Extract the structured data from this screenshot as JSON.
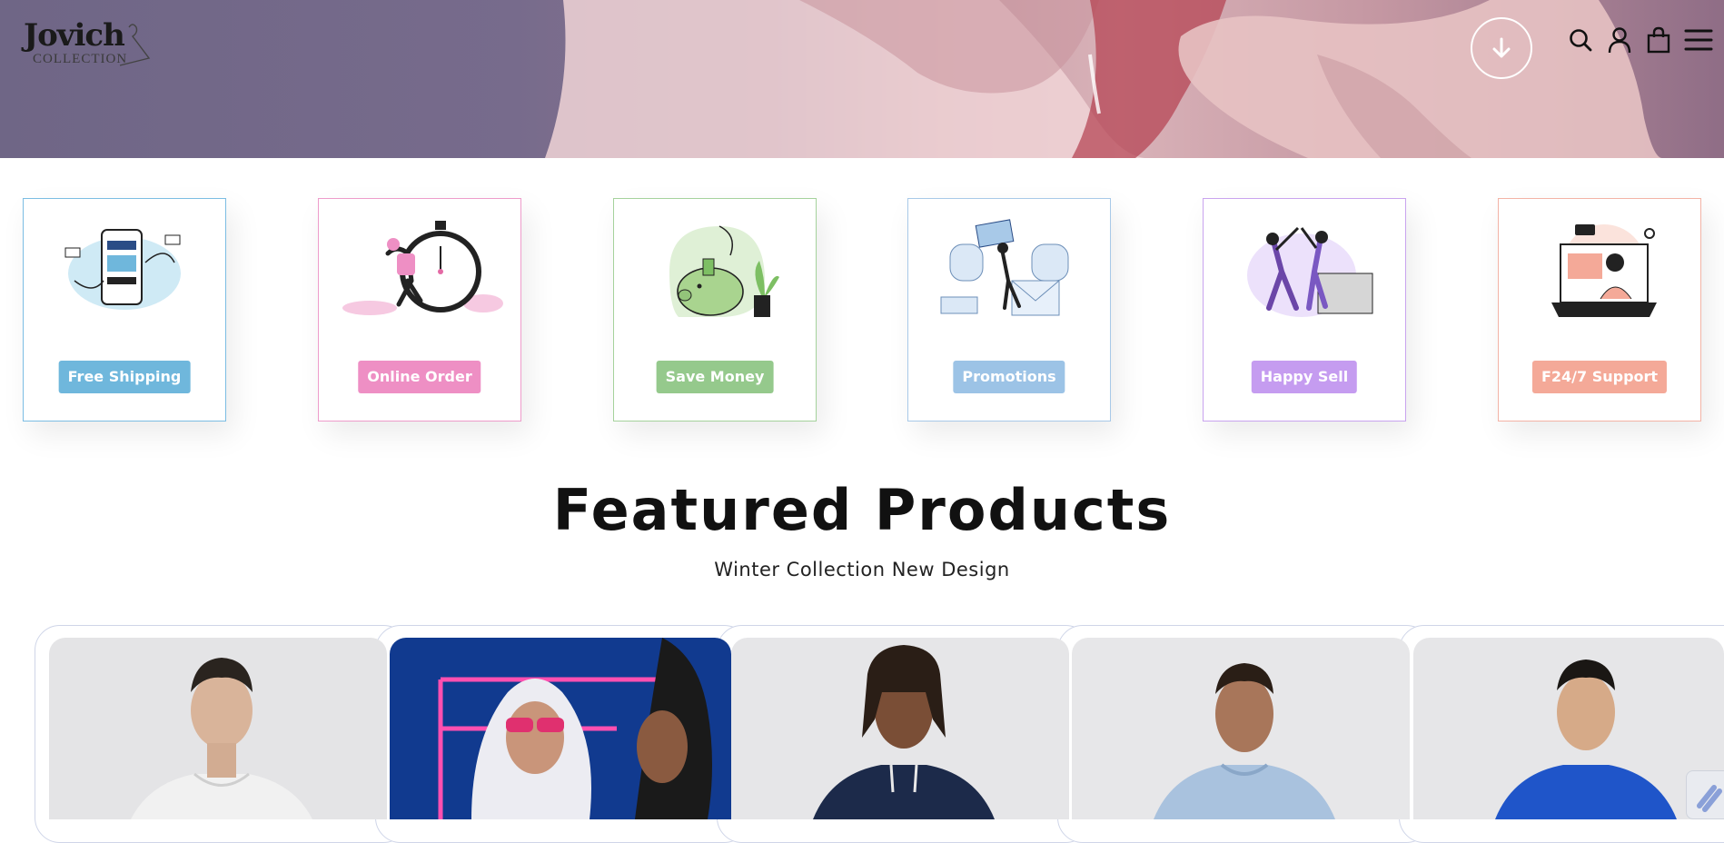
{
  "brand": {
    "name": "Jovich",
    "subtitle": "COLLECTION"
  },
  "header": {
    "icons": [
      "arrow-down-icon",
      "search-icon",
      "user-icon",
      "bag-icon",
      "menu-icon"
    ]
  },
  "features": [
    {
      "label": "Free Shipping",
      "color": "#6fb7dc",
      "border": "#7cbde3",
      "icon": "phone-payment-illustration"
    },
    {
      "label": "Online Order",
      "color": "#ee8fc4",
      "border": "#ee9ccb",
      "icon": "stopwatch-runner-illustration"
    },
    {
      "label": "Save Money",
      "color": "#95c98c",
      "border": "#a5d29c",
      "icon": "piggy-bank-illustration"
    },
    {
      "label": "Promotions",
      "color": "#9cc3e6",
      "border": "#a8c9e8",
      "icon": "gift-envelope-illustration"
    },
    {
      "label": "Happy Sell",
      "color": "#c59cf0",
      "border": "#c9a4ef",
      "icon": "high-five-illustration"
    },
    {
      "label": "F24/7 Support",
      "color": "#f4a998",
      "border": "#f3b3a6",
      "icon": "video-support-illustration"
    }
  ],
  "featured": {
    "title": "Featured Products",
    "subtitle": "Winter Collection New Design"
  },
  "products": [
    {
      "name": "white-hoodie",
      "bg": "#e4e4e6",
      "garment": "#f1f1f1"
    },
    {
      "name": "white-hoodie-neon",
      "bg": "#113a8f",
      "garment": "#e9e9ef"
    },
    {
      "name": "navy-hoodie",
      "bg": "#e6e6e8",
      "garment": "#1c2a4a"
    },
    {
      "name": "light-blue-hoodie",
      "bg": "#e7e7e9",
      "garment": "#a9c2de"
    },
    {
      "name": "royal-blue-hoodie",
      "bg": "#e6e6e8",
      "garment": "#1f55c9"
    }
  ]
}
